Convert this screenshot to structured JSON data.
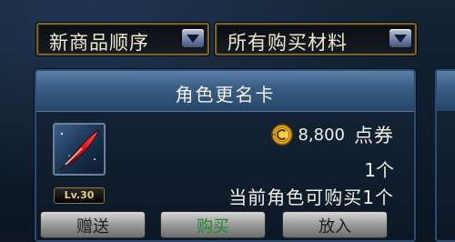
{
  "filters": {
    "sort_label": "新商品顺序",
    "category_label": "所有购买材料"
  },
  "item": {
    "name": "角色更名卡",
    "level_badge": "Lv.30",
    "price_value": "8,800",
    "price_unit": "点券",
    "quantity": "1个",
    "purchase_limit": "当前角色可购买1个"
  },
  "buttons": {
    "gift_label": "赠送",
    "buy_label": "购买",
    "cart_label": "放入"
  },
  "colors": {
    "accent_gold": "#e6d27a",
    "title_bar": "#3a5f86",
    "buy_green": "#1f8a2a"
  },
  "icons": {
    "dropdown": "chevron-down-icon",
    "currency": "coin-icon",
    "item": "feather-quill-icon"
  }
}
